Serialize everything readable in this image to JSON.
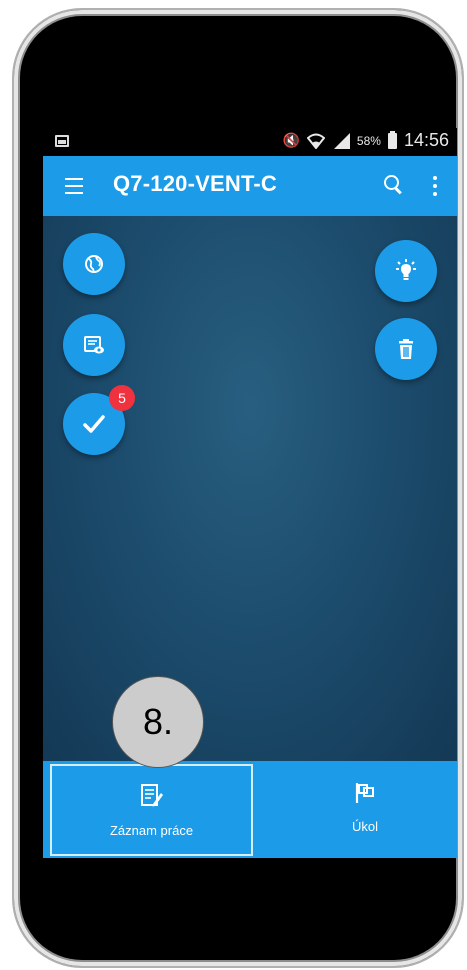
{
  "status_bar": {
    "battery_percent": "58%",
    "time": "14:56"
  },
  "toolbar": {
    "title": "Q7-120-VENT-C"
  },
  "fabs": [
    {
      "name": "globe-button",
      "icon": "globe-icon"
    },
    {
      "name": "form-view-button",
      "icon": "form-eye-icon"
    },
    {
      "name": "tasks-button",
      "icon": "check-icon",
      "badge": "5"
    },
    {
      "name": "idea-button",
      "icon": "lightbulb-icon"
    },
    {
      "name": "delete-button",
      "icon": "trash-icon"
    }
  ],
  "bottom_tabs": {
    "work_log": {
      "label": "Záznam práce",
      "icon": "document-edit-icon"
    },
    "task": {
      "label": "Úkol",
      "icon": "flag-icon"
    }
  },
  "callout": {
    "label": "8."
  },
  "colors": {
    "accent": "#1c9be8",
    "badge": "#f0313e",
    "background": "#1a4a6b"
  }
}
